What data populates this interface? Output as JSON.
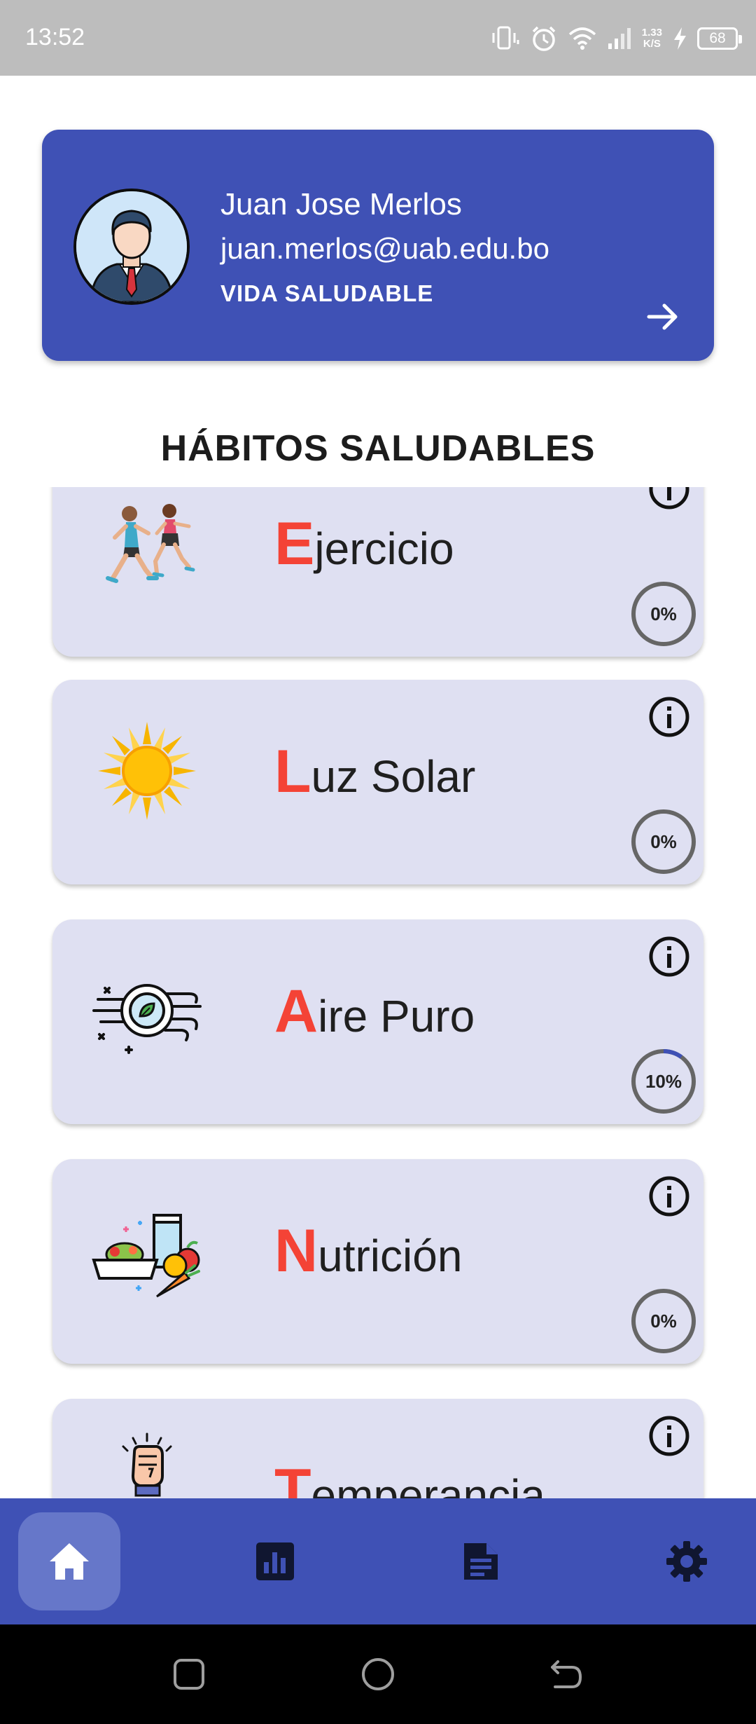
{
  "status_bar": {
    "time": "13:52",
    "net_speed_value": "1.33",
    "net_speed_unit": "K/S",
    "battery": "68",
    "icons": [
      "vibrate-icon",
      "alarm-icon",
      "wifi-icon",
      "signal-icon",
      "charging-icon",
      "battery-icon"
    ]
  },
  "profile": {
    "name": "Juan Jose Merlos",
    "email": "juan.merlos@uab.edu.bo",
    "tag": "VIDA SALUDABLE",
    "arrow_icon": "arrow-right-icon"
  },
  "section_title": "HÁBITOS SALUDABLES",
  "habits": [
    {
      "initial": "E",
      "rest": "jercicio",
      "progress_label": "0%",
      "progress": 0,
      "icon": "running-people-icon"
    },
    {
      "initial": "L",
      "rest": "uz Solar",
      "progress_label": "0%",
      "progress": 0,
      "icon": "sun-icon"
    },
    {
      "initial": "A",
      "rest": "ire Puro",
      "progress_label": "10%",
      "progress": 0.1,
      "icon": "fresh-air-icon"
    },
    {
      "initial": "N",
      "rest": "utrición",
      "progress_label": "0%",
      "progress": 0,
      "icon": "food-icon"
    },
    {
      "initial": "T",
      "rest": "emperancia",
      "progress_label": "",
      "progress": 0,
      "icon": "willpower-icon"
    }
  ],
  "bottom_nav": [
    {
      "icon": "home-icon",
      "active": true
    },
    {
      "icon": "bar-chart-icon",
      "active": false
    },
    {
      "icon": "document-icon",
      "active": false
    },
    {
      "icon": "gear-icon",
      "active": false
    }
  ],
  "colors": {
    "primary": "#3f51b5",
    "card_bg": "#dfe0f2",
    "accent_red": "#f44336",
    "progress_track": "#666666",
    "progress_fill": "#3f51b5"
  }
}
